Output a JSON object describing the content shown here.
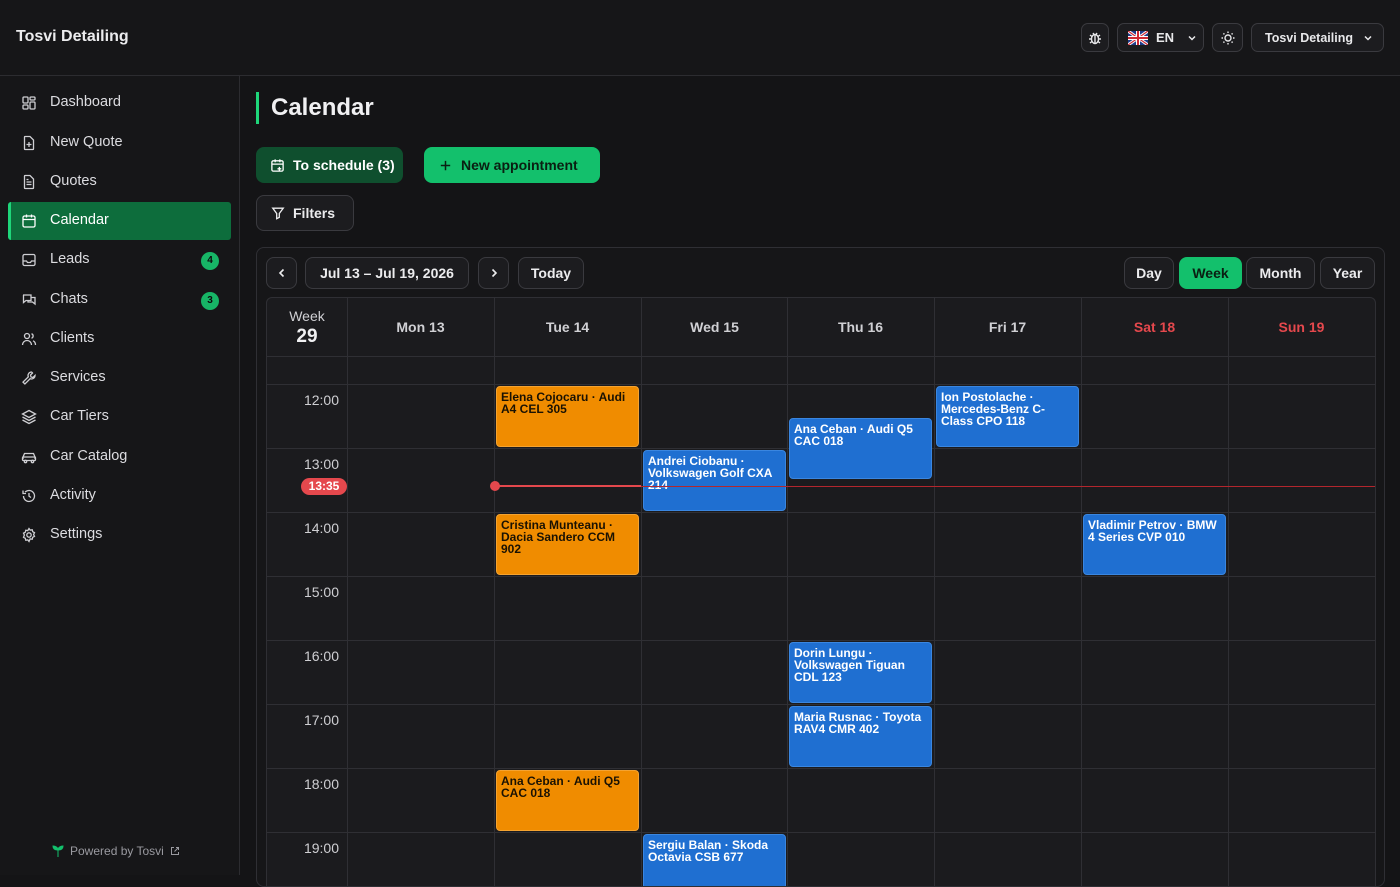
{
  "app": {
    "brand": "Tosvi Detailing"
  },
  "topbar": {
    "language": "EN",
    "account": "Tosvi Detailing"
  },
  "sidebar": {
    "items": [
      {
        "label": "Dashboard",
        "icon": "dashboard-icon"
      },
      {
        "label": "New Quote",
        "icon": "file-plus-icon"
      },
      {
        "label": "Quotes",
        "icon": "file-text-icon"
      },
      {
        "label": "Calendar",
        "icon": "calendar-icon",
        "active": true
      },
      {
        "label": "Leads",
        "icon": "inbox-icon",
        "badge": "4"
      },
      {
        "label": "Chats",
        "icon": "chat-icon",
        "badge": "3"
      },
      {
        "label": "Clients",
        "icon": "users-icon"
      },
      {
        "label": "Services",
        "icon": "wrench-icon"
      },
      {
        "label": "Car Tiers",
        "icon": "layers-icon"
      },
      {
        "label": "Car Catalog",
        "icon": "car-icon"
      },
      {
        "label": "Activity",
        "icon": "history-icon"
      },
      {
        "label": "Settings",
        "icon": "gear-icon"
      }
    ],
    "powered_by": "Powered by Tosvi"
  },
  "page": {
    "title": "Calendar",
    "to_schedule": "To schedule (3)",
    "new_appointment": "New appointment",
    "filters": "Filters"
  },
  "calendar": {
    "range": "Jul 13 – Jul 19, 2026",
    "today": "Today",
    "views": [
      "Day",
      "Week",
      "Month",
      "Year"
    ],
    "active_view": "Week",
    "week_label": "Week",
    "week_number": "29",
    "days": [
      "Mon 13",
      "Tue 14",
      "Wed 15",
      "Thu 16",
      "Fri 17",
      "Sat 18",
      "Sun 19"
    ],
    "hours": [
      "12:00",
      "13:00",
      "14:00",
      "15:00",
      "16:00",
      "17:00",
      "18:00",
      "19:00"
    ],
    "now": "13:35",
    "events": [
      {
        "day": 1,
        "start": 12.0,
        "end": 13.0,
        "color": "orange",
        "text": "Elena Cojocaru · Audi A4 CEL 305"
      },
      {
        "day": 1,
        "start": 14.0,
        "end": 15.0,
        "color": "orange",
        "text": "Cristina Munteanu · Dacia Sandero CCM 902"
      },
      {
        "day": 1,
        "start": 18.0,
        "end": 19.0,
        "color": "orange",
        "text": "Ana Ceban · Audi Q5 CAC 018"
      },
      {
        "day": 2,
        "start": 13.0,
        "end": 14.0,
        "color": "blue",
        "text": "Andrei Ciobanu · Volkswagen Golf CXA 214"
      },
      {
        "day": 2,
        "start": 19.0,
        "end": 20.0,
        "color": "blue",
        "text": "Sergiu Balan · Skoda Octavia CSB 677"
      },
      {
        "day": 3,
        "start": 12.5,
        "end": 13.5,
        "color": "blue",
        "text": "Ana Ceban · Audi Q5 CAC 018"
      },
      {
        "day": 3,
        "start": 16.0,
        "end": 17.0,
        "color": "blue",
        "text": "Dorin Lungu · Volkswagen Tiguan CDL 123"
      },
      {
        "day": 3,
        "start": 17.0,
        "end": 18.0,
        "color": "blue",
        "text": "Maria Rusnac · Toyota RAV4 CMR 402"
      },
      {
        "day": 4,
        "start": 12.0,
        "end": 13.0,
        "color": "blue",
        "text": "Ion Postolache · Mercedes-Benz C-Class CPO 118"
      },
      {
        "day": 5,
        "start": 14.0,
        "end": 15.0,
        "color": "blue",
        "text": "Vladimir Petrov · BMW 4 Series CVP 010"
      }
    ]
  },
  "colors": {
    "accent": "#13c06c",
    "active_nav": "#0d6d3c",
    "event_orange": "#f08c00",
    "event_blue": "#1f6fd1",
    "now": "#e5484d"
  }
}
